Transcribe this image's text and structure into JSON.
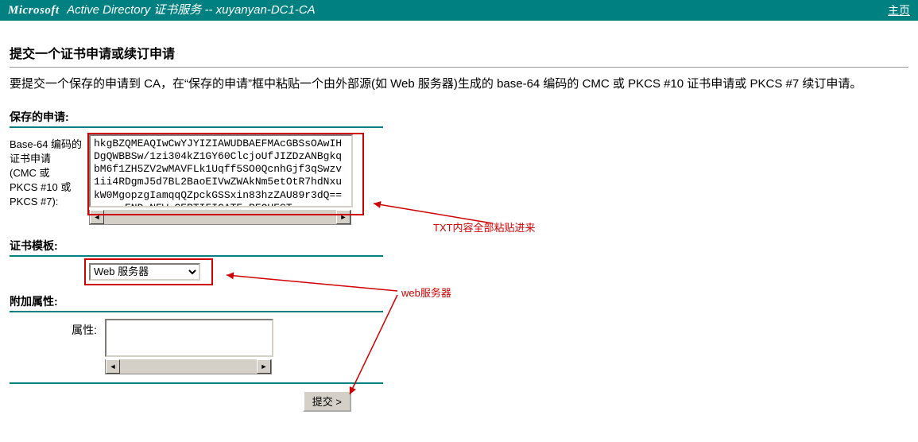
{
  "header": {
    "brand": "Microsoft",
    "service": " Active Directory 证书服务  --  xuyanyan-DC1-CA",
    "home_link": "主页"
  },
  "title": "提交一个证书申请或续订申请",
  "intro": "要提交一个保存的申请到 CA，在“保存的申请”框中粘贴一个由外部源(如 Web 服务器)生成的 base-64 编码的 CMC 或 PKCS #10 证书申请或 PKCS #7 续订申请。",
  "saved_request": {
    "section_label": "保存的申请:",
    "field_label": "Base-64 编码的\n证书申请\n(CMC 或\nPKCS #10 或\nPKCS #7):",
    "value": "hkgBZQMEAQIwCwYJYIZIAWUDBAEFMAcGBSsOAwIH\nDgQWBBSw/1zi304kZ1GY60ClcjoUfJIZDzANBgkq\nbM6f1ZH5ZV2wMAVFLk1Uqff5SO0QcnhGjf3qSwzv\n1ii4RDgmJ5d7BL2BaoEIVwZWAkNm5etOtR7hdNxu\nkW0MgopzgIamqqQZpckGSSxin83hzZAU89r3dQ==\n-----END NEW CERTIFICATE REQUEST-----"
  },
  "template": {
    "section_label": "证书模板:",
    "selected": "Web 服务器",
    "options": [
      "Web 服务器"
    ]
  },
  "attributes": {
    "section_label": "附加属性:",
    "field_label": "属性:",
    "value": ""
  },
  "submit_label": "提交 >",
  "annotations": {
    "paste_hint": "TXT内容全部粘贴进来",
    "template_hint": "web服务器"
  }
}
